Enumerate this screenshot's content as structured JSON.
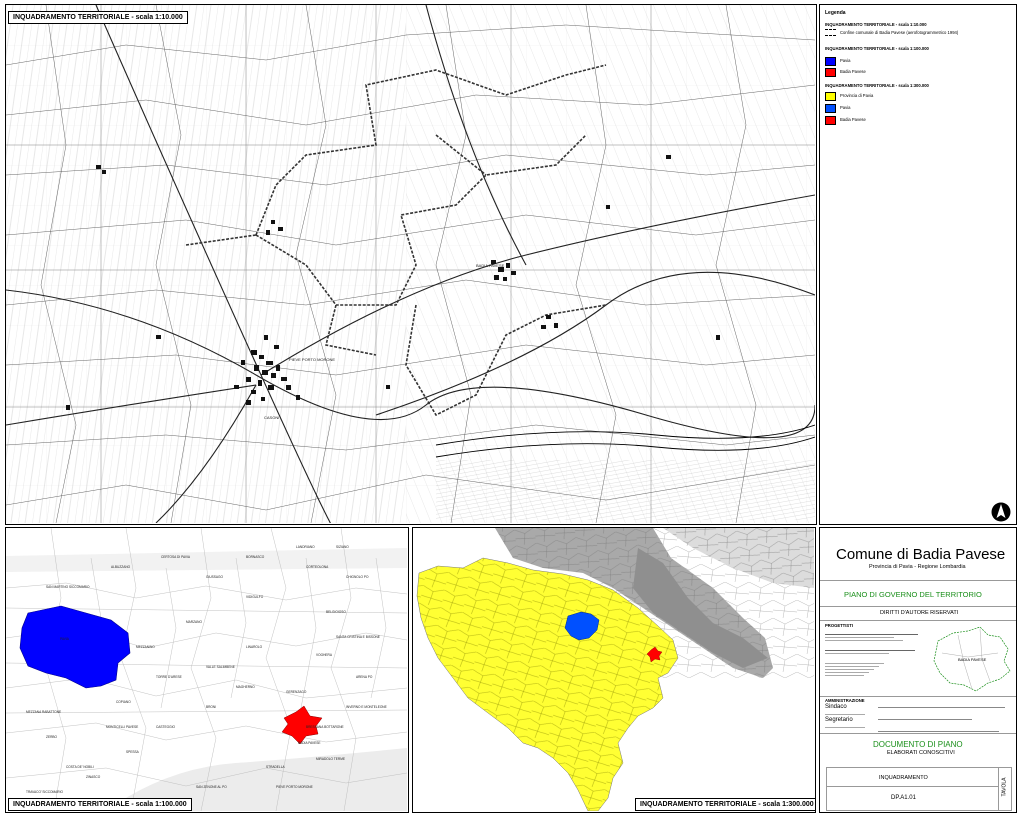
{
  "map_top": {
    "title": "INQUADRAMENTO TERRITORIALE - scala 1:10.000"
  },
  "map_bottom_left": {
    "title": "INQUADRAMENTO TERRITORIALE - scala 1:100.000"
  },
  "map_bottom_mid": {
    "title": "INQUADRAMENTO TERRITORIALE - scala 1:300.000"
  },
  "legend": {
    "title": "Legenda",
    "sec1": {
      "title": "INQUADRAMENTO TERRITORIALE - scala 1:10.000",
      "item": "Confine comunale di Badia Pavese (aerofotogrammetrico 1994)"
    },
    "sec2": {
      "title": "INQUADRAMENTO TERRITORIALE - scala 1:100.000",
      "items": [
        {
          "label": "Pavia",
          "color": "#0000ff"
        },
        {
          "label": "Badia Pavese",
          "color": "#ff0000"
        }
      ]
    },
    "sec3": {
      "title": "INQUADRAMENTO TERRITORIALE - scala 1:300.000",
      "items": [
        {
          "label": "Provincia di Pavia",
          "color": "#ffff00"
        },
        {
          "label": "Pavia",
          "color": "#0050ff"
        },
        {
          "label": "Badia Pavese",
          "color": "#ff0000"
        }
      ]
    }
  },
  "title_block": {
    "comune": "Comune di  Badia Pavese",
    "provincia": "Provincia di Pavia - Regione Lombardia",
    "piano": "PIANO DI GOVERNO DEL TERRITORIO",
    "diritti": "DIRITTI  D'AUTORE  RISERVATI",
    "progettisti": "PROGETTISTI",
    "amministrazione": "AMMINISTRAZIONE",
    "sindaco": "Sindaco",
    "segretario": "Segretario",
    "documento": "DOCUMENTO DI PIANO",
    "elaborati": "ELABORATI CONOSCITIVI",
    "inquadramento": "INQUADRAMENTO",
    "code": "DP.A1.01",
    "tavola": "TAVOLA",
    "inset_label": "BADIA PAVESE"
  },
  "places_top": [
    "PIEVE PORTO MORONE",
    "BADIA PAVESE",
    "CASONI"
  ],
  "places_bl": [
    "PAVIA",
    "BADIA PAVESE",
    "CASTEGGIO",
    "VOGHERA",
    "STRADELLA",
    "BRONI",
    "BELGIOIOSO",
    "SAN MARTINO SICCOMARIO",
    "CORTEOLONA",
    "CHIGNOLO PO",
    "SANTA CRISTINA E BISSONE",
    "ARENA PO",
    "LINAROLO",
    "VALLE SALIMBENE",
    "MEZZANINO",
    "ALBUZZANO",
    "CERTOSA DI PAVIA",
    "GIUSSAGO",
    "BORNASCO",
    "LANDRIANO",
    "SIZIANO",
    "VIDIGULFO",
    "MARZANO",
    "TORRE D'ARESE",
    "COPIANO",
    "MAGHERNO",
    "GERENZAGO",
    "INVERNO E MONTELEONE",
    "MIRADOLO TERME",
    "PIEVE PORTO MORONE",
    "SAN ZENONE AL PO",
    "SPESSA",
    "MONTICELLI PAVESE",
    "ZERBO",
    "COSTA DE' NOBILI",
    "TRAVACO' SICCOMARIO",
    "MEZZANA RABATTONE",
    "ZINASCO",
    "BRESSANA BOTTARONE"
  ]
}
